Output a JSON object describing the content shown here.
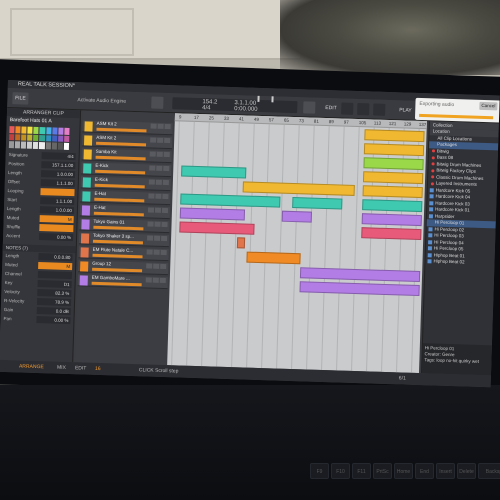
{
  "window": {
    "title": "REAL TALK SESSION*"
  },
  "toolbar": {
    "file_label": "FILE",
    "engine_label": "Activate Audio Engine",
    "tempo_top": "154.2",
    "time_sig": "4/4",
    "position": "3.1.1.00",
    "time": "0:00.000",
    "edit_label": "EDIT",
    "play_label": "PLAY"
  },
  "popup": {
    "text": "Exporting audio",
    "cancel_label": "Cancel",
    "progress": 0.95
  },
  "inspector": {
    "header": "ARRANGER CLIP",
    "clip_name": "Barefoot Hats 01 A",
    "rows": [
      {
        "label": "Signature",
        "value": "4/4"
      },
      {
        "label": "Position",
        "value": "157.1.1.00"
      },
      {
        "label": "Length",
        "value": "1.0.0.00"
      },
      {
        "label": "Offset",
        "value": "1.1.1.00"
      },
      {
        "label": "Looping",
        "value": ""
      },
      {
        "label": "Start",
        "value": "1.1.1.00"
      },
      {
        "label": "Length",
        "value": "1.0.0.00"
      },
      {
        "label": "Muted",
        "value": "M"
      },
      {
        "label": "Shuffle",
        "value": ""
      },
      {
        "label": "Accent",
        "value": "0.00 %"
      }
    ],
    "notes_header": "NOTES (7)",
    "notes_rows": [
      {
        "label": "Length",
        "value": "0.0.0.80"
      },
      {
        "label": "Muted",
        "value": "M"
      },
      {
        "label": "Channel",
        "value": ""
      },
      {
        "label": "Key",
        "value": "D1"
      },
      {
        "label": "Velocity",
        "value": "82.3 %"
      },
      {
        "label": "R-Velocity",
        "value": "78.9 %"
      },
      {
        "label": "Gain",
        "value": "0.0 dB"
      },
      {
        "label": "Pan",
        "value": "0.00 %"
      }
    ]
  },
  "tracks": [
    {
      "name": "ASM Kit 2",
      "color": "#f0b830"
    },
    {
      "name": "ASM Kit 2",
      "color": "#f0b830"
    },
    {
      "name": "Samba Kit",
      "color": "#f0b830"
    },
    {
      "name": "E-Kick",
      "color": "#3ec9b0"
    },
    {
      "name": "E-Kick",
      "color": "#3ec9b0"
    },
    {
      "name": "E-Hat",
      "color": "#3ec9b0"
    },
    {
      "name": "E-Hat",
      "color": "#b37de6"
    },
    {
      "name": "Tokyo Gains 01",
      "color": "#b37de6"
    },
    {
      "name": "Tokyo Shaker 3 sp...",
      "color": "#e0744a"
    },
    {
      "name": "EM Flute Natale C...",
      "color": "#e0744a"
    },
    {
      "name": "Group 12",
      "color": "#f08a24"
    },
    {
      "name": "EM GamboMare ...",
      "color": "#b37de6"
    }
  ],
  "ruler": [
    "9",
    "17",
    "25",
    "33",
    "41",
    "49",
    "57",
    "65",
    "73",
    "81",
    "89",
    "97",
    "105",
    "113",
    "121",
    "129",
    "137"
  ],
  "browser": {
    "header": "Collection",
    "items": [
      {
        "label": "Location",
        "style": "head"
      },
      {
        "label": "All Clip Locations",
        "style": ""
      },
      {
        "label": "Packages",
        "style": "sel"
      },
      {
        "label": "Bitwig",
        "style": "dot"
      },
      {
        "label": "Bass 08",
        "style": "dot"
      },
      {
        "label": "Bitwig Drum Machines",
        "style": "dot"
      },
      {
        "label": "Bitwig Factory Clips",
        "style": "dot"
      },
      {
        "label": "Classic Drum Machines",
        "style": "dot"
      },
      {
        "label": "Layered Instruments",
        "style": "dot"
      },
      {
        "label": "Hardcore Kick 05",
        "style": "blue"
      },
      {
        "label": "Hardcore Kick 04",
        "style": "blue"
      },
      {
        "label": "Hardcore Kick 03",
        "style": "blue"
      },
      {
        "label": "Hardcore Kick 01",
        "style": "blue"
      },
      {
        "label": "Harpsider",
        "style": "blue"
      },
      {
        "label": "Hi Percloop 01",
        "style": "sel"
      },
      {
        "label": "Hi Percloop 02",
        "style": "blue"
      },
      {
        "label": "Hi Percloop 03",
        "style": "blue"
      },
      {
        "label": "Hi Percloop 04",
        "style": "blue"
      },
      {
        "label": "Hi Percloop 05",
        "style": "blue"
      },
      {
        "label": "Hiphop Beat 01",
        "style": "blue"
      },
      {
        "label": "Hiphop Beat 02",
        "style": "blue"
      }
    ],
    "footer": [
      "Hi Percloop 01",
      "Creator: Genre",
      "Tags: loop no-hit quirky wet"
    ]
  },
  "bottombar": {
    "tabs": [
      "ARRANGE",
      "MIX",
      "EDIT"
    ],
    "zoom": "16",
    "status": "CLICK Scroll step",
    "page": "6/1"
  },
  "keyboard": [
    "F9",
    "F10",
    "F11",
    "PrtSc",
    "Home",
    "End",
    "Insert",
    "Delete",
    "Backspace"
  ],
  "colors": {
    "accent": "#f08a24",
    "teal": "#3ec9b0",
    "yellow": "#f0b830",
    "purple": "#b37de6"
  }
}
